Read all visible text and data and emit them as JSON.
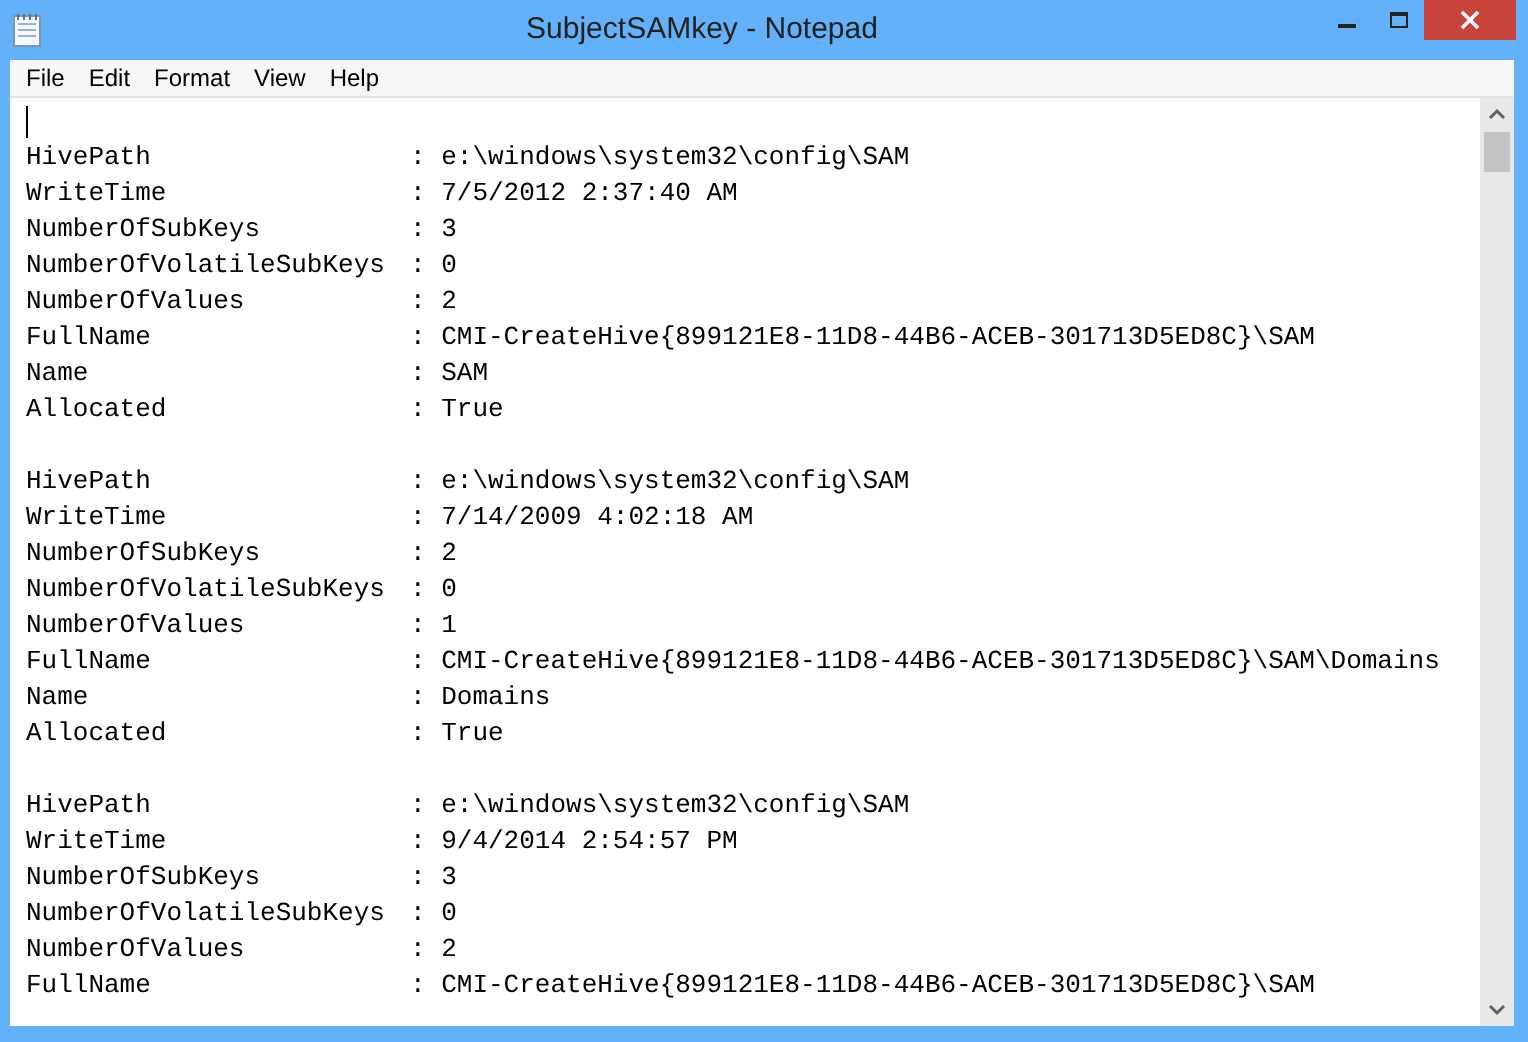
{
  "window": {
    "title": "SubjectSAMkey - Notepad"
  },
  "menu": [
    "File",
    "Edit",
    "Format",
    "View",
    "Help"
  ],
  "document": {
    "records": [
      {
        "fields": [
          {
            "key": "HivePath",
            "value": ": e:\\windows\\system32\\config\\SAM"
          },
          {
            "key": "WriteTime",
            "value": ": 7/5/2012 2:37:40 AM"
          },
          {
            "key": "NumberOfSubKeys",
            "value": ": 3"
          },
          {
            "key": "NumberOfVolatileSubKeys",
            "value": ": 0"
          },
          {
            "key": "NumberOfValues",
            "value": ": 2"
          },
          {
            "key": "FullName",
            "value": ": CMI-CreateHive{899121E8-11D8-44B6-ACEB-301713D5ED8C}\\SAM"
          },
          {
            "key": "Name",
            "value": ": SAM"
          },
          {
            "key": "Allocated",
            "value": ": True"
          }
        ]
      },
      {
        "fields": [
          {
            "key": "HivePath",
            "value": ": e:\\windows\\system32\\config\\SAM"
          },
          {
            "key": "WriteTime",
            "value": ": 7/14/2009 4:02:18 AM"
          },
          {
            "key": "NumberOfSubKeys",
            "value": ": 2"
          },
          {
            "key": "NumberOfVolatileSubKeys",
            "value": ": 0"
          },
          {
            "key": "NumberOfValues",
            "value": ": 1"
          },
          {
            "key": "FullName",
            "value": ": CMI-CreateHive{899121E8-11D8-44B6-ACEB-301713D5ED8C}\\SAM\\Domains"
          },
          {
            "key": "Name",
            "value": ": Domains"
          },
          {
            "key": "Allocated",
            "value": ": True"
          }
        ]
      },
      {
        "fields": [
          {
            "key": "HivePath",
            "value": ": e:\\windows\\system32\\config\\SAM"
          },
          {
            "key": "WriteTime",
            "value": ": 9/4/2014 2:54:57 PM"
          },
          {
            "key": "NumberOfSubKeys",
            "value": ": 3"
          },
          {
            "key": "NumberOfVolatileSubKeys",
            "value": ": 0"
          },
          {
            "key": "NumberOfValues",
            "value": ": 2"
          },
          {
            "key": "FullName",
            "value": ": CMI-CreateHive{899121E8-11D8-44B6-ACEB-301713D5ED8C}\\SAM"
          }
        ]
      }
    ]
  }
}
